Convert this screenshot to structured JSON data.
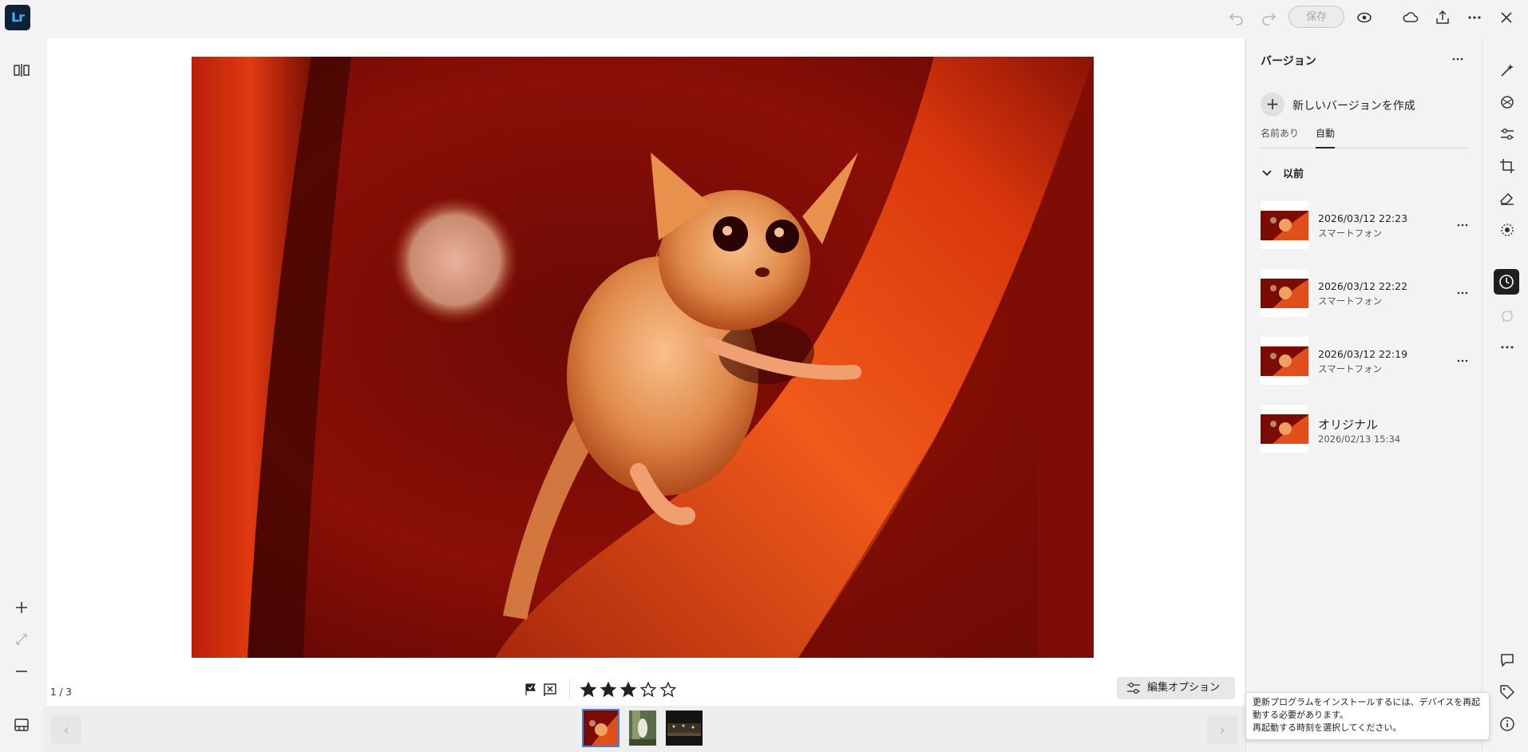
{
  "app": {
    "logo_text": "Lr"
  },
  "toolbar": {
    "save_label": "保存"
  },
  "viewer": {
    "page_count": "1 / 3",
    "rating": 3,
    "rating_max": 5,
    "edit_options_label": "編集オプション"
  },
  "versions_panel": {
    "title": "バージョン",
    "new_version_label": "新しいバージョンを作成",
    "tabs": [
      {
        "label": "名前あり",
        "active": false
      },
      {
        "label": "自動",
        "active": true
      }
    ],
    "section_label": "以前",
    "items": [
      {
        "date": "2026/03/12 22:23",
        "source": "スマートフォン"
      },
      {
        "date": "2026/03/12 22:22",
        "source": "スマートフォン"
      },
      {
        "date": "2026/03/12 22:19",
        "source": "スマートフォン"
      }
    ],
    "original": {
      "label": "オリジナル",
      "date": "2026/02/13 15:34"
    }
  },
  "toast": {
    "line1": "更新プログラムをインストールするには、デバイスを再起動する必要があります。",
    "line2": "再起動する時刻を選択してください。"
  },
  "colors": {
    "accent": "#1473e6",
    "logo_bg": "#0f2137",
    "logo_text": "#41b1f5"
  }
}
